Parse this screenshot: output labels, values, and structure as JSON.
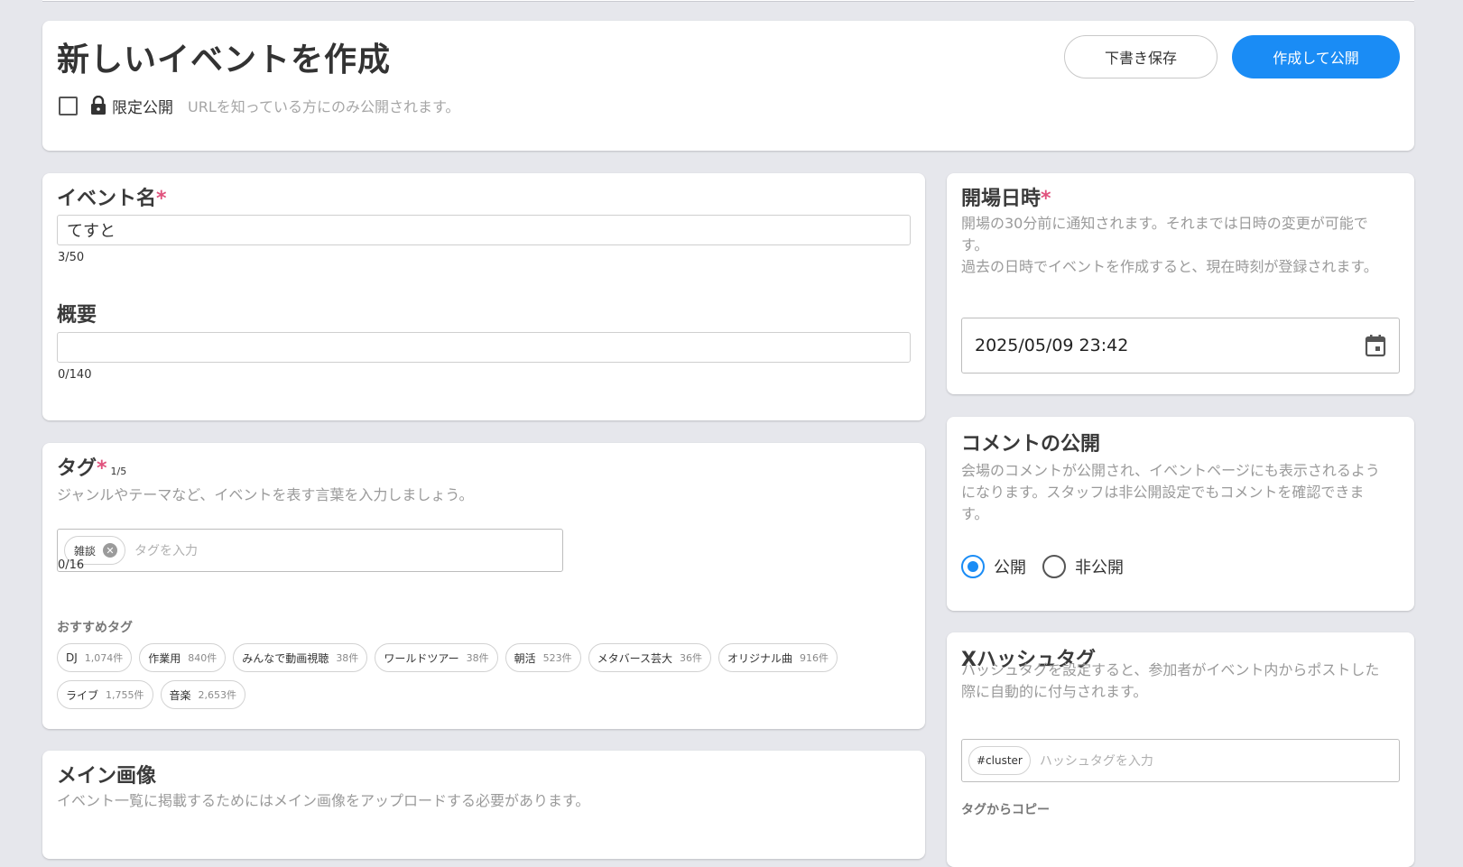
{
  "header": {
    "title": "新しいイベントを作成",
    "draft_button": "下書き保存",
    "publish_button": "作成して公開",
    "limited_label": "限定公開",
    "limited_hint": "URLを知っている方にのみ公開されます。"
  },
  "event": {
    "name_label": "イベント名",
    "required_mark": "*",
    "name_value": "てすと",
    "name_counter": "3/50",
    "summary_label": "概要",
    "summary_value": "",
    "summary_counter": "0/140"
  },
  "tags": {
    "label": "タグ",
    "required_mark": "*",
    "count": "1/5",
    "hint": "ジャンルやテーマなど、イベントを表す言葉を入力しましょう。",
    "selected": [
      "雑談"
    ],
    "placeholder": "タグを入力",
    "counter": "0/16",
    "suggest_label": "おすすめタグ",
    "suggested": [
      {
        "name": "DJ",
        "count": "1,074件"
      },
      {
        "name": "作業用",
        "count": "840件"
      },
      {
        "name": "みんなで動画視聴",
        "count": "38件"
      },
      {
        "name": "ワールドツアー",
        "count": "38件"
      },
      {
        "name": "朝活",
        "count": "523件"
      },
      {
        "name": "メタバース芸大",
        "count": "36件"
      },
      {
        "name": "オリジナル曲",
        "count": "916件"
      },
      {
        "name": "ライブ",
        "count": "1,755件"
      },
      {
        "name": "音楽",
        "count": "2,653件"
      }
    ]
  },
  "main_image": {
    "label": "メイン画像",
    "hint": "イベント一覧に掲載するためにはメイン画像をアップロードする必要があります。"
  },
  "datetime": {
    "label": "開場日時",
    "required_mark": "*",
    "hint_line1": "開場の30分前に通知されます。それまでは日時の変更が可能です。",
    "hint_line2": "過去の日時でイベントを作成すると、現在時刻が登録されます。",
    "value": "2025/05/09 23:42",
    "icon": "calendar-icon"
  },
  "comment": {
    "label": "コメントの公開",
    "hint": "会場のコメントが公開され、イベントページにも表示されるようになります。スタッフは非公開設定でもコメントを確認できます。",
    "options": [
      "公開",
      "非公開"
    ],
    "selected": "公開"
  },
  "hashtag": {
    "label": "Xハッシュタグ",
    "hint": "ハッシュタグを設定すると、参加者がイベント内からポストした際に自動的に付与されます。",
    "chip": "#cluster",
    "placeholder": "ハッシュタグを入力",
    "copy_label": "タグからコピー"
  },
  "colors": {
    "accent": "#1a8cf5",
    "required": "#e0527d",
    "background": "#e6e7ec"
  }
}
